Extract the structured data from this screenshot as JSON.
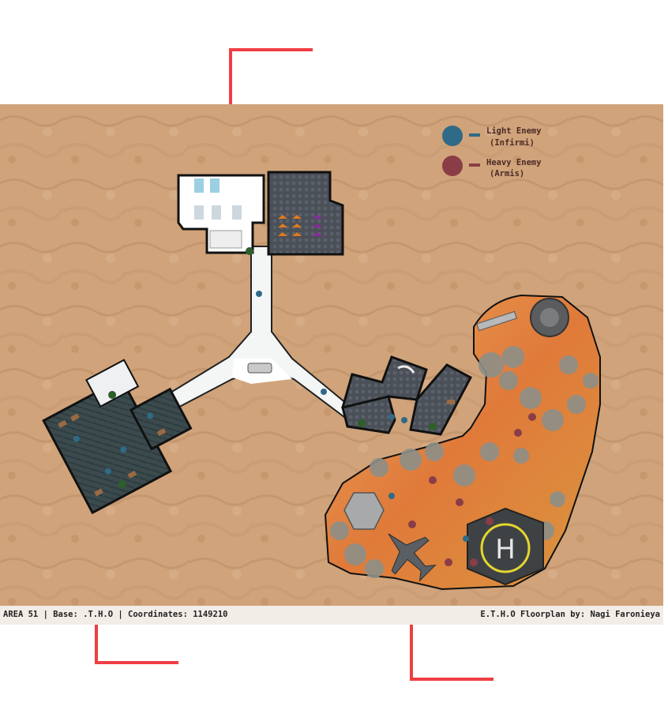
{
  "legend": {
    "items": [
      {
        "label_line1": "Light Enemy",
        "label_line2": "(Infirmi)",
        "color": "#2f6a86"
      },
      {
        "label_line1": "Heavy Enemy",
        "label_line2": "(Armis)",
        "color": "#8a3d46"
      }
    ]
  },
  "footer": {
    "left_text": "AREA 51 | Base: .T.H.O | Coordinates: 1149210",
    "right_text": "E.T.H.O Floorplan by: Nagi Faronieya"
  },
  "colors": {
    "callout": "#ef3e42",
    "terrain": "#d0a37a",
    "light_enemy": "#2f6a86",
    "heavy_enemy": "#8a3d46"
  },
  "icons": {
    "helipad": "helipad-icon",
    "aircraft": "fighter-jet-icon"
  },
  "helipad_letter": "H"
}
